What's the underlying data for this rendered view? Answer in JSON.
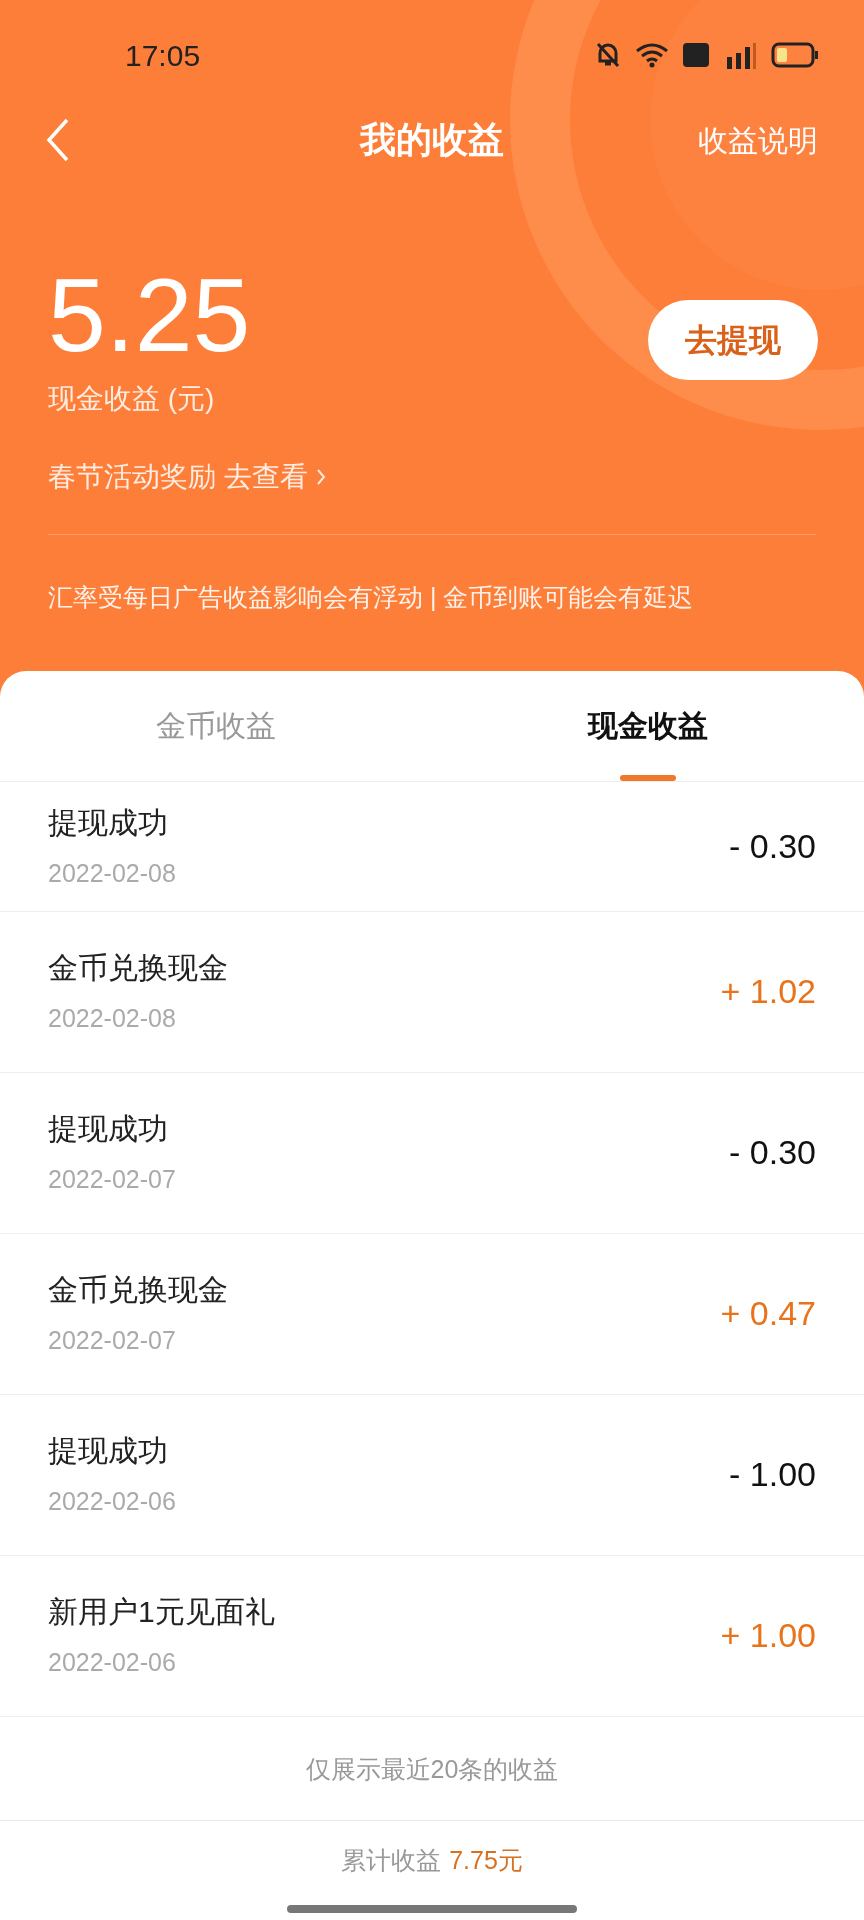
{
  "status_bar": {
    "time": "17:05"
  },
  "nav": {
    "title": "我的收益",
    "action": "收益说明"
  },
  "balance": {
    "amount": "5.25",
    "label": "现金收益 (元)",
    "withdraw_button": "去提现",
    "promo_link": "春节活动奖励 去查看",
    "notice": "汇率受每日广告收益影响会有浮动 | 金币到账可能会有延迟"
  },
  "tabs": [
    {
      "label": "金币收益",
      "selected": false
    },
    {
      "label": "现金收益",
      "selected": true
    }
  ],
  "records": [
    {
      "title": "提现成功",
      "date": "2022-02-08",
      "amount": "- 0.30",
      "kind": "expense"
    },
    {
      "title": "金币兑换现金",
      "date": "2022-02-08",
      "amount": "+ 1.02",
      "kind": "income"
    },
    {
      "title": "提现成功",
      "date": "2022-02-07",
      "amount": "- 0.30",
      "kind": "expense"
    },
    {
      "title": "金币兑换现金",
      "date": "2022-02-07",
      "amount": "+ 0.47",
      "kind": "income"
    },
    {
      "title": "提现成功",
      "date": "2022-02-06",
      "amount": "- 1.00",
      "kind": "expense"
    },
    {
      "title": "新用户1元见面礼",
      "date": "2022-02-06",
      "amount": "+ 1.00",
      "kind": "income"
    }
  ],
  "list_note": "仅展示最近20条的收益",
  "total": {
    "label": "累计收益",
    "value": "7.75元"
  }
}
